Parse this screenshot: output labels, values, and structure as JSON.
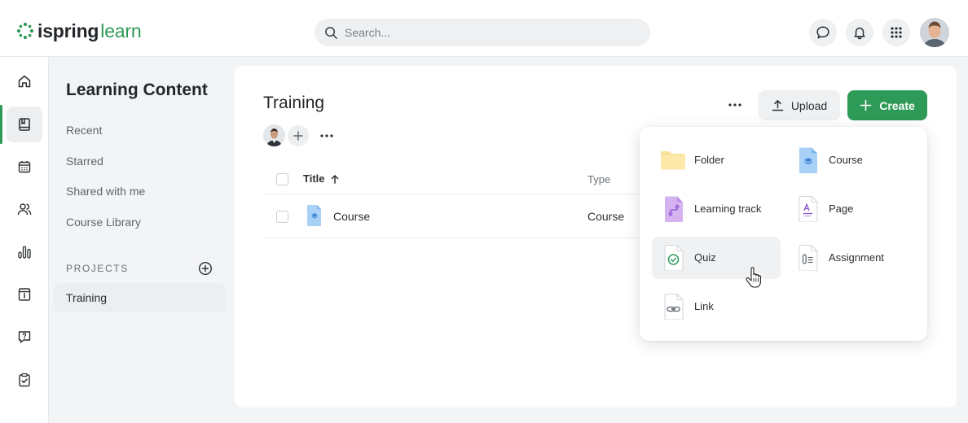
{
  "brand": {
    "name_bold": "ispring",
    "name_light": "learn",
    "color": "#2e9a57"
  },
  "search": {
    "placeholder": "Search...",
    "value": ""
  },
  "topbar_icons": [
    "chat-icon",
    "bell-icon",
    "apps-grid-icon"
  ],
  "rail": {
    "items": [
      "home-icon",
      "book-icon",
      "calendar-icon",
      "users-icon",
      "chart-icon",
      "info-card-icon",
      "help-icon",
      "clipboard-check-icon"
    ],
    "active_index": 1
  },
  "nav": {
    "title": "Learning Content",
    "links": [
      "Recent",
      "Starred",
      "Shared with me",
      "Course Library"
    ],
    "projects_label": "PROJECTS",
    "projects": [
      "Training"
    ]
  },
  "main": {
    "title": "Training",
    "upload_label": "Upload",
    "create_label": "Create",
    "table": {
      "headers": {
        "title": "Title",
        "type": "Type"
      },
      "rows": [
        {
          "name": "Course",
          "type": "Course"
        }
      ]
    }
  },
  "create_menu": {
    "items": [
      {
        "label": "Folder",
        "icon": "folder-icon"
      },
      {
        "label": "Course",
        "icon": "course-icon"
      },
      {
        "label": "Learning track",
        "icon": "learning-track-icon"
      },
      {
        "label": "Page",
        "icon": "page-icon"
      },
      {
        "label": "Quiz",
        "icon": "quiz-icon"
      },
      {
        "label": "Assignment",
        "icon": "assignment-icon"
      },
      {
        "label": "Link",
        "icon": "link-icon"
      }
    ],
    "hovered": "Quiz"
  }
}
